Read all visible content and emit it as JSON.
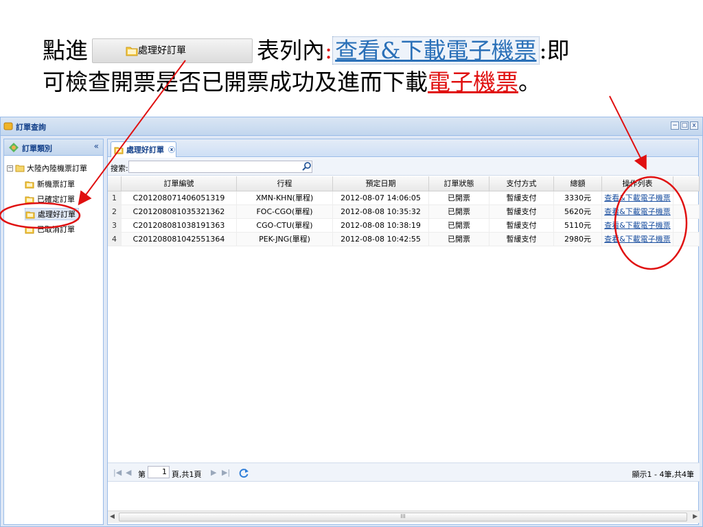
{
  "instruction": {
    "line1_prefix": "點進",
    "button_label": "處理好訂單",
    "line1_mid": "表列內",
    "colon_mark": ":",
    "link_text": "查看&下載電子機票",
    "line1_suffix": ":即",
    "line2_text": "可檢查開票是否已開票成功及進而下載",
    "line2_link": "電子機票",
    "line2_end": "。"
  },
  "window": {
    "title": "訂單查詢",
    "controls": [
      "−",
      "□",
      "x"
    ]
  },
  "left_panel": {
    "title": "訂單類別",
    "collapse_glyph": "«",
    "tree_root": "大陸內陸機票訂單",
    "items": [
      {
        "label": "新機票訂單"
      },
      {
        "label": "已確定訂單"
      },
      {
        "label": "處理好訂單"
      },
      {
        "label": "已取消訂單"
      }
    ]
  },
  "tab": {
    "label": "處理好訂單",
    "close": "x"
  },
  "search": {
    "label": "搜索:",
    "value": ""
  },
  "grid": {
    "columns": [
      "",
      "訂單編號",
      "行程",
      "預定日期",
      "訂單狀態",
      "支付方式",
      "總額",
      "操作列表",
      ""
    ],
    "rows": [
      {
        "no": "1",
        "order": "C201208071406051319",
        "route": "XMN-KHN(單程)",
        "date": "2012-08-07 14:06:05",
        "status": "已開票",
        "pay": "暫緩支付",
        "total": "3330元",
        "action": "查看&下載電子機票"
      },
      {
        "no": "2",
        "order": "C201208081035321362",
        "route": "FOC-CGO(單程)",
        "date": "2012-08-08 10:35:32",
        "status": "已開票",
        "pay": "暫緩支付",
        "total": "5620元",
        "action": "查看&下載電子機票"
      },
      {
        "no": "3",
        "order": "C201208081038191363",
        "route": "CGO-CTU(單程)",
        "date": "2012-08-08 10:38:19",
        "status": "已開票",
        "pay": "暫緩支付",
        "total": "5110元",
        "action": "查看&下載電子機票"
      },
      {
        "no": "4",
        "order": "C201208081042551364",
        "route": "PEK-JNG(單程)",
        "date": "2012-08-08 10:42:55",
        "status": "已開票",
        "pay": "暫緩支付",
        "total": "2980元",
        "action": "查看&下載電子機票"
      }
    ]
  },
  "paging": {
    "page_prefix": "第",
    "page_value": "1",
    "page_suffix": "頁,共1頁",
    "info": "顯示1 - 4筆,共4筆"
  },
  "scroll": {
    "thumb_grip": "III"
  },
  "colors": {
    "annotation_red": "#e01010",
    "ext_header": "#15428b",
    "link": "#1a4fa0"
  }
}
